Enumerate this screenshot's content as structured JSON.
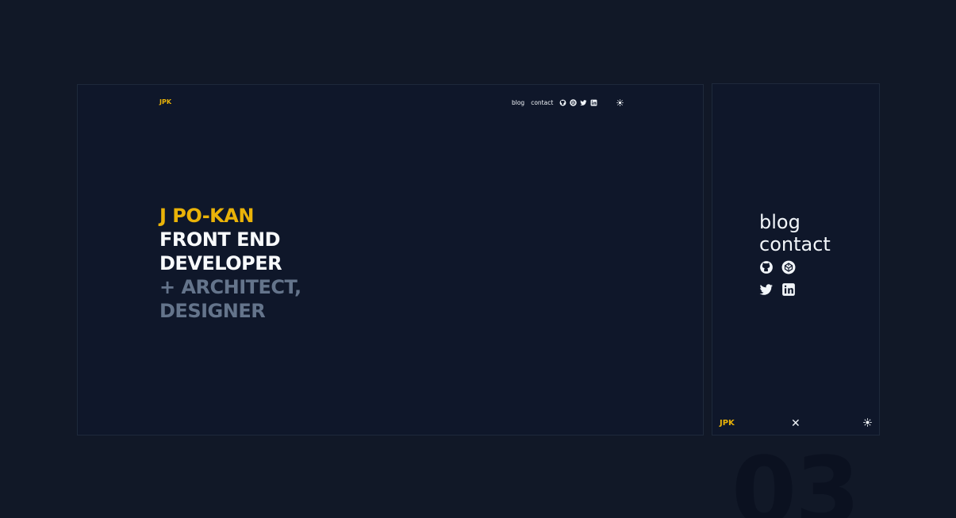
{
  "background_number": "03",
  "desktop": {
    "logo": "JPK",
    "nav": {
      "blog": "blog",
      "contact": "contact",
      "icons": [
        "github-icon",
        "codepen-icon",
        "twitter-icon",
        "linkedin-icon"
      ],
      "theme_icon": "sun-icon"
    },
    "hero": {
      "line1": "J PO-KAN",
      "line2": "FRONT END",
      "line3": "DEVELOPER",
      "line4": "+ ARCHITECT,",
      "line5": "DESIGNER"
    }
  },
  "mobile": {
    "menu": {
      "blog": "blog",
      "contact": "contact",
      "icons": [
        "github-icon",
        "codepen-icon",
        "twitter-icon",
        "linkedin-icon"
      ]
    },
    "footer": {
      "logo": "JPK",
      "close": "✕",
      "theme_icon": "sun-icon"
    }
  },
  "colors": {
    "background": "#111827",
    "panel": "#0f172a",
    "accent": "#eab308",
    "text": "#f8fafc",
    "muted": "#64748b"
  }
}
